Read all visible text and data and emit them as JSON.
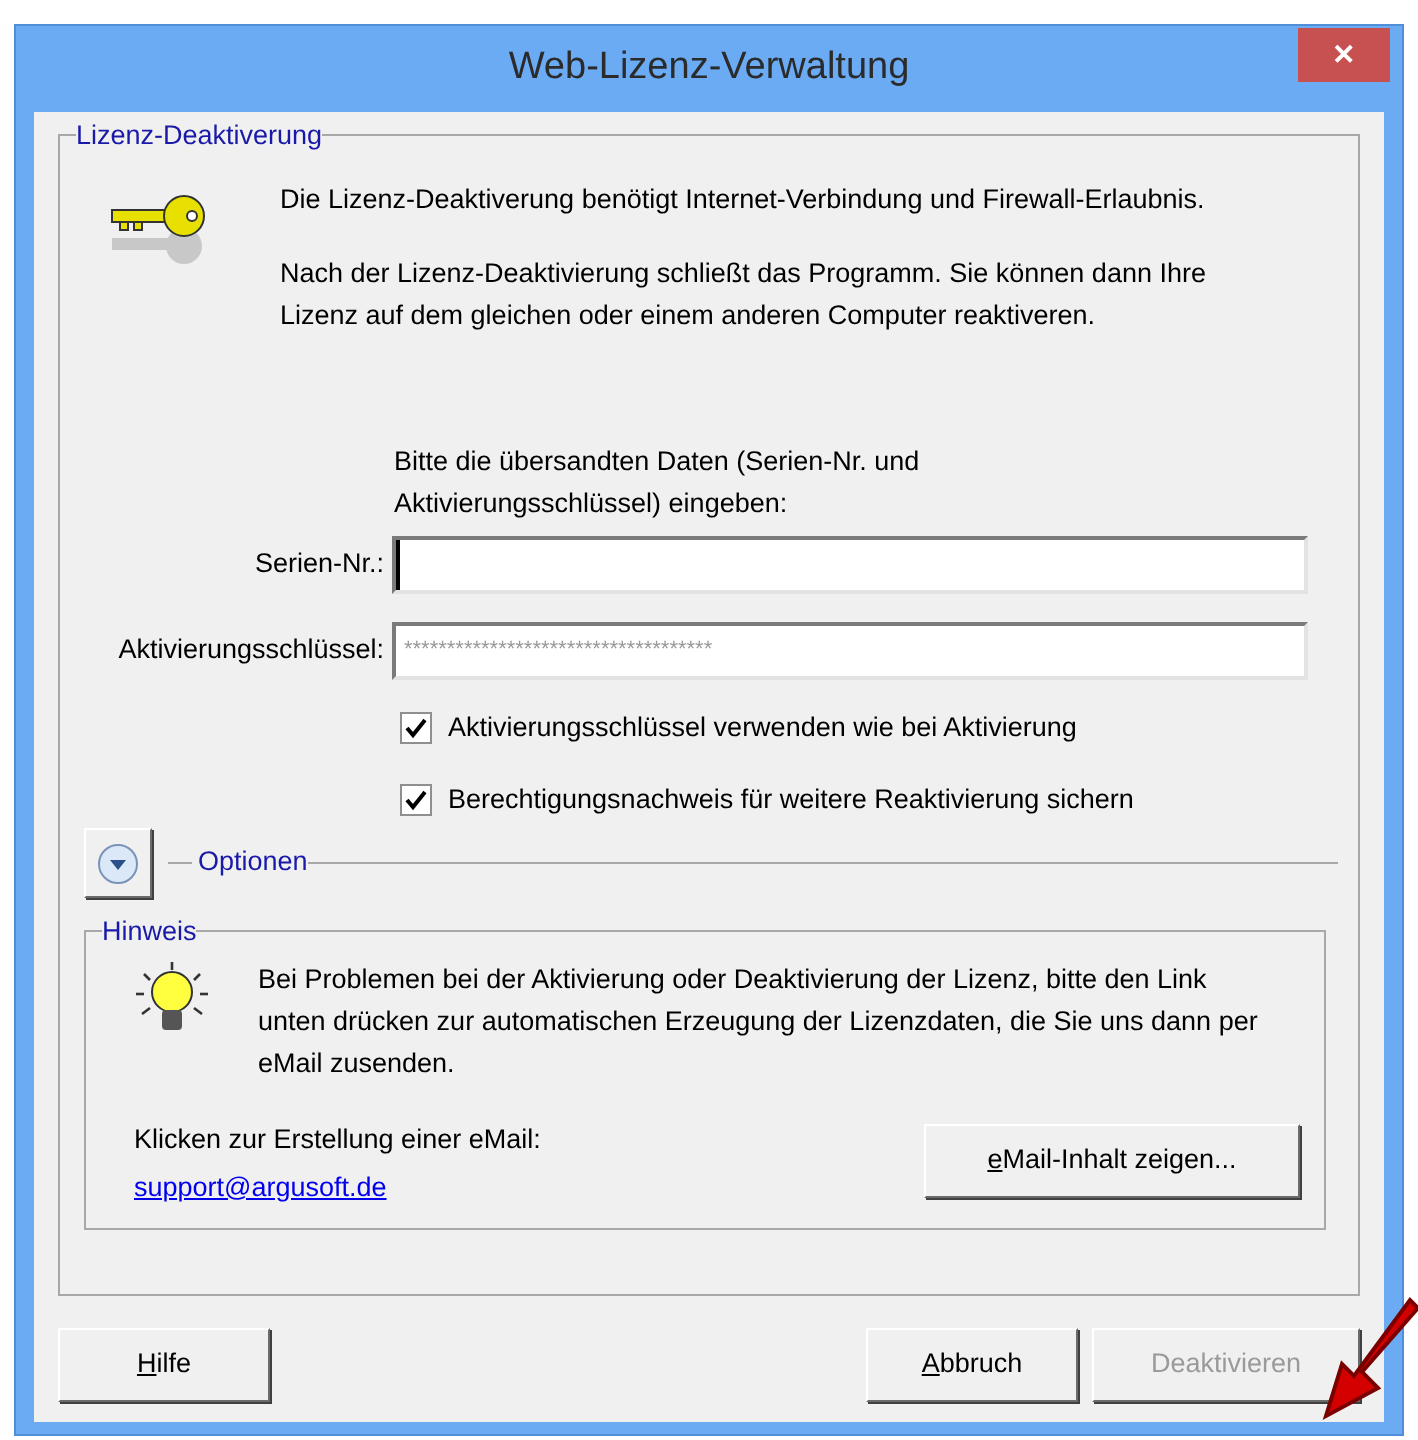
{
  "window": {
    "title": "Web-Lizenz-Verwaltung",
    "close_glyph": "✕"
  },
  "deactivation": {
    "legend": "Lizenz-Deaktiverung",
    "paragraphs": [
      "Die Lizenz-Deaktiverung benötigt Internet-Verbindung und Firewall-Erlaubnis.",
      "Nach der Lizenz-Deaktivierung schließt das Programm. Sie können dann Ihre Lizenz auf dem gleichen oder einem anderen Computer reaktiveren."
    ],
    "instruction": "Bitte die übersandten Daten (Serien-Nr. und Aktivierungsschlüssel) eingeben:",
    "fields": [
      {
        "label": "Serien-Nr.:",
        "disabled": false,
        "focused": true
      },
      {
        "label": "Aktivierungsschlüssel:",
        "value": "************************************",
        "disabled": true,
        "focused": false
      }
    ],
    "checkboxes": [
      {
        "label": "Aktivierungsschlüssel verwenden wie bei Aktivierung",
        "checked": true
      },
      {
        "label": "Berechtigungsnachweis für weitere Reaktivierung sichern",
        "checked": true
      }
    ],
    "options": {
      "label": "Optionen",
      "expanded": false
    }
  },
  "hint": {
    "legend": "Hinweis",
    "text": "Bei Problemen bei der Aktivierung oder Deaktivierung der Lizenz, bitte den Link unten drücken zur automatischen Erzeugung der Lizenzdaten, die Sie uns dann per eMail zusenden.",
    "email_prompt": "Klicken zur Erstellung einer eMail:",
    "email_link": "support@argusoft.de",
    "button": {
      "label": "eMail-Inhalt zeigen...",
      "underline_first": true,
      "disabled": false
    }
  },
  "buttons": [
    {
      "label": "Hilfe",
      "underline_first": true,
      "disabled": false
    },
    {
      "label": "Abbruch",
      "underline_first": true,
      "disabled": false
    },
    {
      "label": "Deaktivieren",
      "underline_first": false,
      "disabled": true
    }
  ]
}
